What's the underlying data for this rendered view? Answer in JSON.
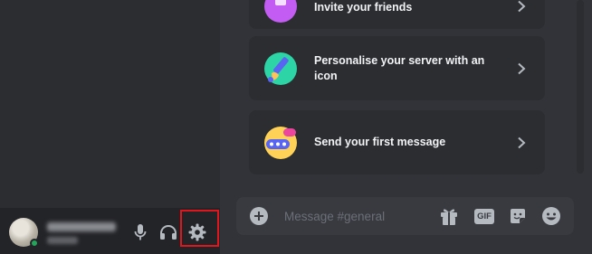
{
  "main": {
    "cards": [
      {
        "label": "Invite your friends",
        "icon": "invite-friends-icon"
      },
      {
        "label": "Personalise your server with an icon",
        "icon": "personalise-server-icon"
      },
      {
        "label": "Send your first message",
        "icon": "first-message-icon"
      }
    ]
  },
  "composer": {
    "placeholder": "Message #general",
    "gif_label": "GIF"
  },
  "user_panel": {
    "status": "online"
  },
  "colors": {
    "accent_highlight": "#e0161e",
    "online": "#23a55a",
    "background": "#313338",
    "sidebar": "#2b2d31"
  }
}
